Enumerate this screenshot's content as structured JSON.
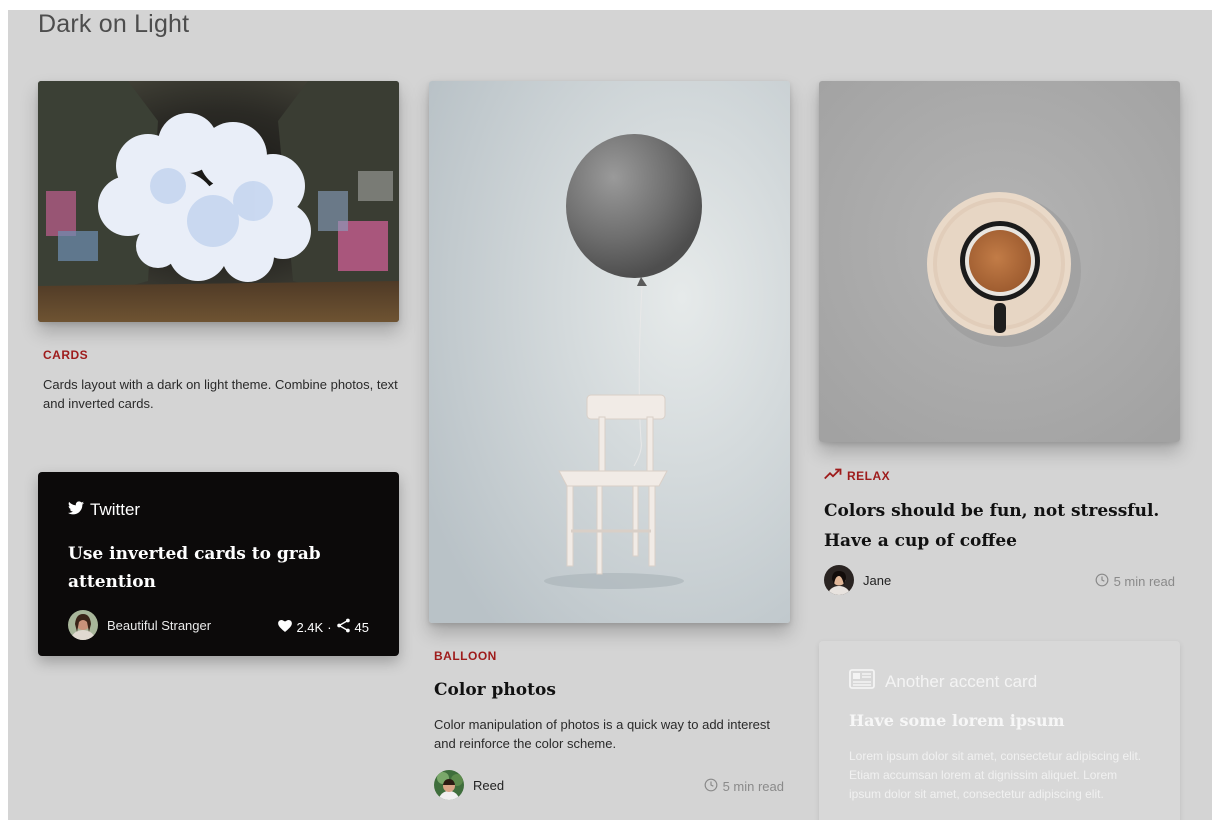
{
  "page": {
    "title": "Dark on Light"
  },
  "cards_card": {
    "category": "CARDS",
    "description": "Cards layout with a dark on light theme. Combine photos, text and inverted cards."
  },
  "twitter_card": {
    "brand": "Twitter",
    "title": "Use inverted cards to grab attention",
    "author": "Beautiful Stranger",
    "likes": "2.4K",
    "separator": "·",
    "shares": "45"
  },
  "balloon_card": {
    "category": "BALLOON",
    "title": "Color photos",
    "description": "Color manipulation of photos is a quick way to add interest and reinforce the color scheme.",
    "author": "Reed",
    "read_time": "5 min read"
  },
  "relax_card": {
    "category": "RELAX",
    "title": "Colors should be fun, not stressful. Have a cup of coffee",
    "author": "Jane",
    "read_time": "5 min read"
  },
  "accent_card": {
    "brand": "Another accent card",
    "title": "Have some lorem ipsum",
    "body": "Lorem ipsum dolor sit amet, consectetur adipiscing elit. Etiam accumsan lorem at dignissim aliquet. Lorem ipsum dolor sit amet, consectetur adipiscing elit."
  },
  "colors": {
    "accent_red": "#9e1b1b",
    "page_bg": "#d4d4d4",
    "dark_card_bg": "#0c0a0a"
  },
  "icons": {
    "twitter": "twitter-bird-icon",
    "heart": "heart-icon",
    "share": "share-icon",
    "clock": "clock-icon",
    "trend": "trending-up-icon",
    "news": "newspaper-icon"
  }
}
